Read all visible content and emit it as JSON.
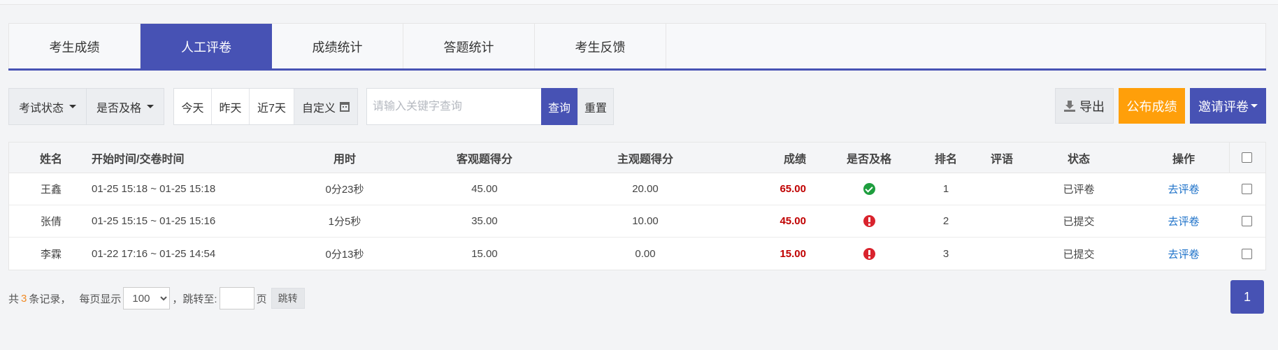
{
  "tabs": [
    {
      "label": "考生成绩",
      "active": false
    },
    {
      "label": "人工评卷",
      "active": true
    },
    {
      "label": "成绩统计",
      "active": false
    },
    {
      "label": "答题统计",
      "active": false
    },
    {
      "label": "考生反馈",
      "active": false
    }
  ],
  "filters": {
    "exam_status": "考试状态",
    "pass_status": "是否及格",
    "dates": [
      "今天",
      "昨天",
      "近7天",
      "自定义"
    ]
  },
  "search": {
    "placeholder": "请输入关键字查询",
    "query_label": "查询",
    "reset_label": "重置"
  },
  "actions": {
    "export": "导出",
    "publish": "公布成绩",
    "invite": "邀请评卷"
  },
  "table": {
    "headers": [
      "姓名",
      "开始时间/交卷时间",
      "用时",
      "客观题得分",
      "主观题得分",
      "成绩",
      "是否及格",
      "排名",
      "评语",
      "状态",
      "操作"
    ],
    "rows": [
      {
        "name": "王鑫",
        "time": "01-25 15:18 ~ 01-25 15:18",
        "duration": "0分23秒",
        "objective": "45.00",
        "subjective": "20.00",
        "score": "65.00",
        "pass": "pass-icon",
        "rank": "1",
        "comment": "",
        "status": "已评卷",
        "action": "去评卷"
      },
      {
        "name": "张倩",
        "time": "01-25 15:15 ~ 01-25 15:16",
        "duration": "1分5秒",
        "objective": "35.00",
        "subjective": "10.00",
        "score": "45.00",
        "pass": "fail-icon",
        "rank": "2",
        "comment": "",
        "status": "已提交",
        "action": "去评卷"
      },
      {
        "name": "李霖",
        "time": "01-22 17:16 ~ 01-25 14:54",
        "duration": "0分13秒",
        "objective": "15.00",
        "subjective": "0.00",
        "score": "15.00",
        "pass": "fail-icon",
        "rank": "3",
        "comment": "",
        "status": "已提交",
        "action": "去评卷"
      }
    ]
  },
  "pager": {
    "total_prefix": "共",
    "total_count": "3",
    "total_suffix": "条记录，",
    "per_page_label": "每页显示",
    "per_page_value": "100",
    "jump_label": "，跳转至:",
    "page_unit": "页",
    "jump_button": "跳转",
    "current_page": "1"
  },
  "colors": {
    "primary": "#4752b4",
    "publish": "#ff9f0a",
    "score_red": "#c00000",
    "pass_green": "#1e9e3e",
    "fail_red": "#d9232d",
    "link_blue": "#1e72c9"
  }
}
